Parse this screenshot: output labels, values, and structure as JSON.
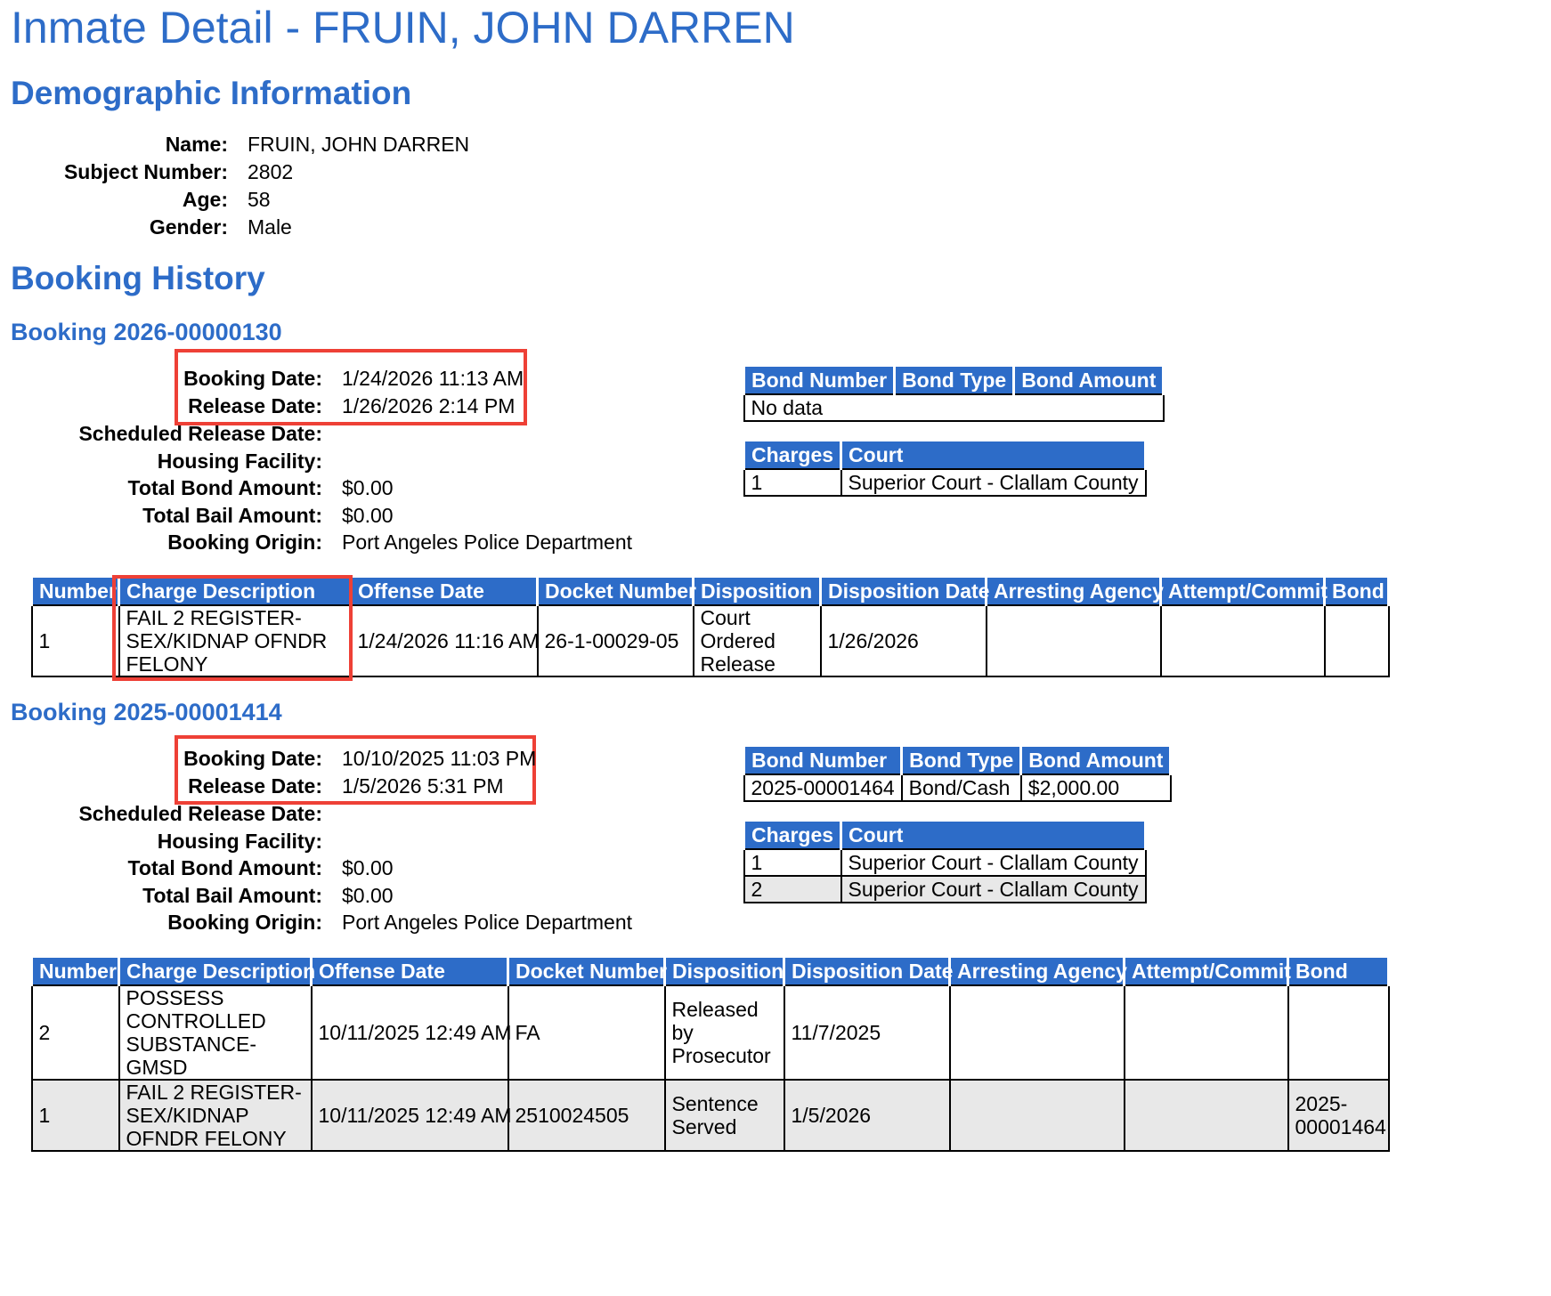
{
  "page_title": "Inmate Detail - FRUIN, JOHN DARREN",
  "demographic": {
    "heading": "Demographic Information",
    "rows": [
      {
        "label": "Name:",
        "value": "FRUIN, JOHN DARREN"
      },
      {
        "label": "Subject Number:",
        "value": "2802"
      },
      {
        "label": "Age:",
        "value": "58"
      },
      {
        "label": "Gender:",
        "value": "Male"
      }
    ]
  },
  "booking_history_heading": "Booking History",
  "charge_headers": [
    "Number",
    "Charge Description",
    "Offense Date",
    "Docket Number",
    "Disposition",
    "Disposition Date",
    "Arresting Agency",
    "Attempt/Commit",
    "Bond"
  ],
  "bond_headers": [
    "Bond Number",
    "Bond Type",
    "Bond Amount"
  ],
  "court_headers": [
    "Charges",
    "Court"
  ],
  "bookings": [
    {
      "heading": "Booking 2026-00000130",
      "fields": [
        {
          "label": "Booking Date:",
          "value": "1/24/2026 11:13 AM"
        },
        {
          "label": "Release Date:",
          "value": "1/26/2026 2:14 PM"
        },
        {
          "label": "Scheduled Release Date:",
          "value": ""
        },
        {
          "label": "Housing Facility:",
          "value": ""
        },
        {
          "label": "Total Bond Amount:",
          "value": "$0.00"
        },
        {
          "label": "Total Bail Amount:",
          "value": "$0.00"
        },
        {
          "label": "Booking Origin:",
          "value": "Port Angeles Police Department"
        }
      ],
      "bonds_no_data": "No data",
      "courts": [
        {
          "charges": "1",
          "court": "Superior Court - Clallam County"
        }
      ],
      "charges": [
        {
          "number": "1",
          "description": "FAIL 2 REGISTER-SEX/KIDNAP OFNDR FELONY",
          "offense_date": "1/24/2026 11:16 AM",
          "docket": "26-1-00029-05",
          "disposition": "Court Ordered Release",
          "disposition_date": "1/26/2026",
          "agency": "",
          "attempt": "",
          "bond": ""
        }
      ]
    },
    {
      "heading": "Booking 2025-00001414",
      "fields": [
        {
          "label": "Booking Date:",
          "value": "10/10/2025 11:03 PM"
        },
        {
          "label": "Release Date:",
          "value": "1/5/2026 5:31 PM"
        },
        {
          "label": "Scheduled Release Date:",
          "value": ""
        },
        {
          "label": "Housing Facility:",
          "value": ""
        },
        {
          "label": "Total Bond Amount:",
          "value": "$0.00"
        },
        {
          "label": "Total Bail Amount:",
          "value": "$0.00"
        },
        {
          "label": "Booking Origin:",
          "value": "Port Angeles Police Department"
        }
      ],
      "bonds": [
        {
          "number": "2025-00001464",
          "type": "Bond/Cash",
          "amount": "$2,000.00"
        }
      ],
      "courts": [
        {
          "charges": "1",
          "court": "Superior Court - Clallam County"
        },
        {
          "charges": "2",
          "court": "Superior Court - Clallam County"
        }
      ],
      "charges": [
        {
          "number": "2",
          "description": "POSSESS CONTROLLED SUBSTANCE-GMSD",
          "offense_date": "10/11/2025 12:49 AM",
          "docket": "FA",
          "disposition": "Released by Prosecutor",
          "disposition_date": "11/7/2025",
          "agency": "",
          "attempt": "",
          "bond": ""
        },
        {
          "number": "1",
          "description": "FAIL 2 REGISTER-SEX/KIDNAP OFNDR FELONY",
          "offense_date": "10/11/2025 12:49 AM",
          "docket": "2510024505",
          "disposition": "Sentence Served",
          "disposition_date": "1/5/2026",
          "agency": "",
          "attempt": "",
          "bond": "2025-00001464"
        }
      ]
    }
  ],
  "highlight_color": "#ee4036",
  "accent_color": "#2d6cc8"
}
